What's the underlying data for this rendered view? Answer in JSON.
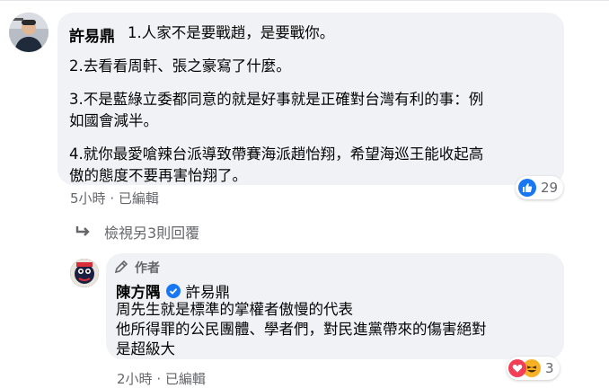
{
  "comment": {
    "author": "許易鼎",
    "lines": [
      "1.人家不是要戰趙，是要戰你。",
      "2.去看看周軒、張之豪寫了什麼。",
      "3.不是藍綠立委都同意的就是好事就是正確對台灣有利的事：例",
      "如國會減半。",
      "4.就你最愛嗆辣台派導致帶賽海派趙怡翔，希望海巡王能收起高",
      "傲的態度不要再害怡翔了。"
    ],
    "time": "5小時",
    "separator": "·",
    "edited": "已編輯",
    "reaction_count": "29",
    "reaction_icon": "like-icon"
  },
  "view_more": {
    "label": "檢視另3則回覆"
  },
  "reply": {
    "badge": "作者",
    "author": "陳方隅",
    "verified": true,
    "tagged": "許易鼎",
    "lines": [
      "周先生就是標準的掌權者傲慢的代表",
      "他所得罪的公民團體、學者們，對民進黨帶來的傷害絕對",
      "是超級大"
    ],
    "time": "2小時",
    "separator": "·",
    "edited": "已編輯",
    "reaction_count": "3",
    "reaction_icons": [
      "love-icon",
      "haha-icon"
    ]
  },
  "colors": {
    "like_blue": "#1877f2",
    "love_red": "#f33e58",
    "haha_yellow": "#f7b125",
    "secondary_text": "#65676b",
    "bubble_bg": "#f0f2f5"
  }
}
